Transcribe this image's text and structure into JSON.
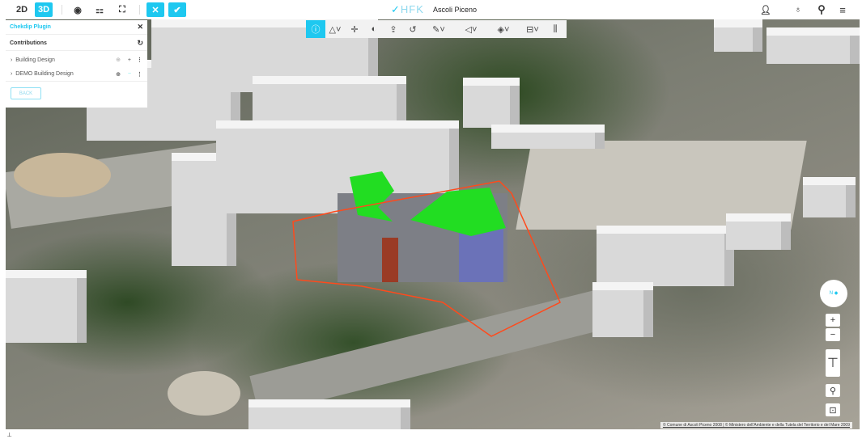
{
  "topbar": {
    "btn_2d": "2D",
    "btn_3d": "3D",
    "logo": "HFK",
    "city": "Ascoli Piceno"
  },
  "plugin": {
    "title": "Chekdip Plugin",
    "section": "Contributions",
    "items": [
      {
        "label": "Building Design"
      },
      {
        "label": "DEMO Building Design"
      }
    ],
    "back": "BACK"
  },
  "toolbar": {
    "icons": [
      "info-icon",
      "polygon-icon",
      "measure-icon",
      "shadow-icon",
      "upload-icon",
      "rotate-icon",
      "draw-icon",
      "angle-icon",
      "view-icon",
      "layer-icon",
      "chart-icon"
    ]
  },
  "controls": {
    "zoom_in": "+",
    "zoom_out": "−"
  },
  "attribution": "© Comune di Ascoli Piceno 2008 | © Ministero dell'Ambiente e della Tutela del Territorio e del Mare 2009",
  "colors": {
    "accent": "#1ec8f0",
    "roof": "#22dd22",
    "outline": "#ff4a1c"
  }
}
